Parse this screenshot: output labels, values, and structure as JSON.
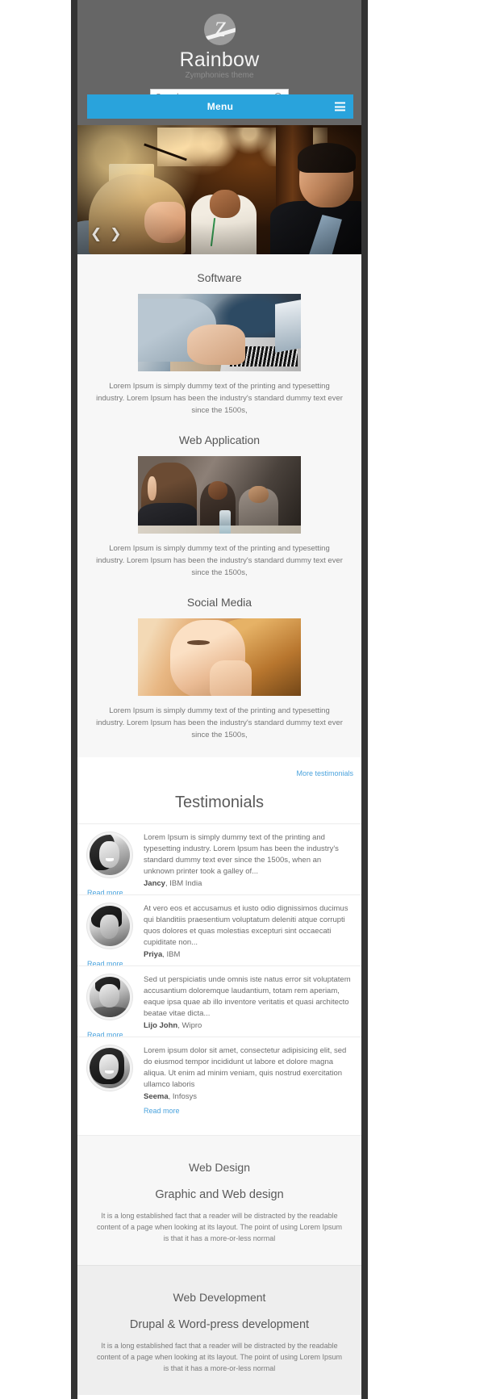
{
  "header": {
    "logo_icon": "z-logo-icon",
    "site_title": "Rainbow",
    "slogan": "Zymphonies theme",
    "search": {
      "placeholder": "Search",
      "value": "",
      "icon": "search-icon"
    },
    "menu_label": "Menu",
    "hamburger_icon": "hamburger-icon",
    "accent_color": "#29a3dc",
    "header_bg": "#666666"
  },
  "slider": {
    "prev_icon": "chevron-left-icon",
    "next_icon": "chevron-right-icon",
    "slide_alt": "networking-event-photo"
  },
  "services": [
    {
      "title": "Software",
      "image_alt": "hands-typing-on-laptop",
      "description": "Lorem Ipsum is simply dummy text of the printing and typesetting industry. Lorem Ipsum has been the industry's standard dummy text ever since the 1500s,"
    },
    {
      "title": "Web Application",
      "image_alt": "students-studying-at-table",
      "description": "Lorem Ipsum is simply dummy text of the printing and typesetting industry. Lorem Ipsum has been the industry's standard dummy text ever since the 1500s,"
    },
    {
      "title": "Social Media",
      "image_alt": "woman-on-phone-closeup",
      "description": "Lorem Ipsum is simply dummy text of the printing and typesetting industry. Lorem Ipsum has been the industry's standard dummy text ever since the 1500s,"
    }
  ],
  "testimonials": {
    "more_link": "More testimonials",
    "heading": "Testimonials",
    "read_more_label": "Read more",
    "items": [
      {
        "avatar_alt": "avatar-jancy",
        "text": "Lorem Ipsum is simply dummy text of the printing and typesetting industry. Lorem Ipsum has been the industry's standard dummy text ever since the 1500s, when an unknown printer took a galley of...",
        "author": "Jancy",
        "company": "IBM India",
        "read_more_position": "left"
      },
      {
        "avatar_alt": "avatar-priya",
        "text": "At vero eos et accusamus et iusto odio dignissimos ducimus qui blanditiis praesentium voluptatum deleniti atque corrupti quos dolores et quas molestias excepturi sint occaecati cupiditate non...",
        "author": "Priya",
        "company": "IBM",
        "read_more_position": "left"
      },
      {
        "avatar_alt": "avatar-lijo-john",
        "text": "Sed ut perspiciatis unde omnis iste natus error sit voluptatem accusantium doloremque laudantium, totam rem aperiam, eaque ipsa quae ab illo inventore veritatis et quasi architecto beatae vitae dicta...",
        "author": "Lijo John",
        "company": "Wipro",
        "read_more_position": "left"
      },
      {
        "avatar_alt": "avatar-seema",
        "text": "Lorem ipsum dolor sit amet, consectetur adipisicing elit, sed do eiusmod tempor incididunt ut labore et dolore magna aliqua. Ut enim ad minim veniam, quis nostrud exercitation ullamco laboris",
        "author": "Seema",
        "company": "Infosys",
        "read_more_position": "inline"
      }
    ]
  },
  "panels": [
    {
      "kicker": "Web Design",
      "title": "Graphic and Web design",
      "text": "It is a long established fact that a reader will be distracted by the readable content of a page when looking at its layout. The point of using Lorem Ipsum is that it has a more-or-less normal"
    },
    {
      "kicker": "Web Development",
      "title": "Drupal & Word-press development",
      "text": "It is a long established fact that a reader will be distracted by the readable content of a page when looking at its layout. The point of using Lorem Ipsum is that it has a more-or-less normal"
    }
  ]
}
